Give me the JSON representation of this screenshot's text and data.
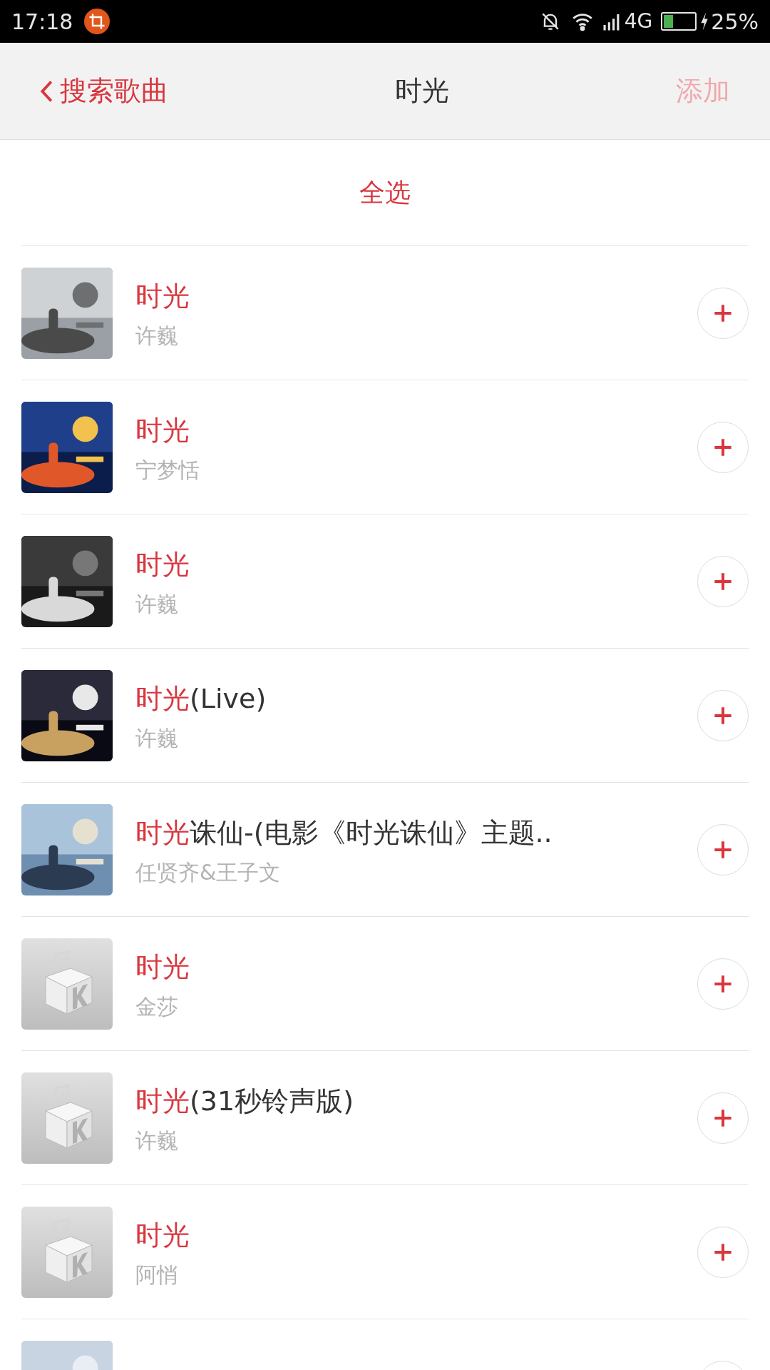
{
  "status_bar": {
    "time": "17:18",
    "network": "4G",
    "battery": "25%"
  },
  "header": {
    "back_label": "搜索歌曲",
    "title": "时光",
    "action": "添加",
    "action_disabled": true
  },
  "select_all": "全选",
  "songs": [
    {
      "kind": "picture",
      "title_highlight": "时光",
      "artist": "许巍"
    },
    {
      "kind": "picture",
      "title_highlight": "时光",
      "artist": "宁梦恬"
    },
    {
      "kind": "picture",
      "title_highlight": "时光",
      "artist": "许巍"
    },
    {
      "kind": "picture",
      "title_highlight": "时光",
      "title_rest": "(Live)",
      "artist": "许巍"
    },
    {
      "kind": "picture",
      "title_highlight": "时光",
      "title_rest": "诛仙-(电影《时光诛仙》主题..",
      "artist": "任贤齐&王子文"
    },
    {
      "kind": "placeholder",
      "title_highlight": "时光",
      "artist": "金莎"
    },
    {
      "kind": "placeholder",
      "title_highlight": "时光",
      "title_rest": "(31秒铃声版)",
      "artist": "许巍"
    },
    {
      "kind": "placeholder",
      "title_highlight": "时光",
      "artist": "阿悄"
    },
    {
      "kind": "picture"
    }
  ]
}
